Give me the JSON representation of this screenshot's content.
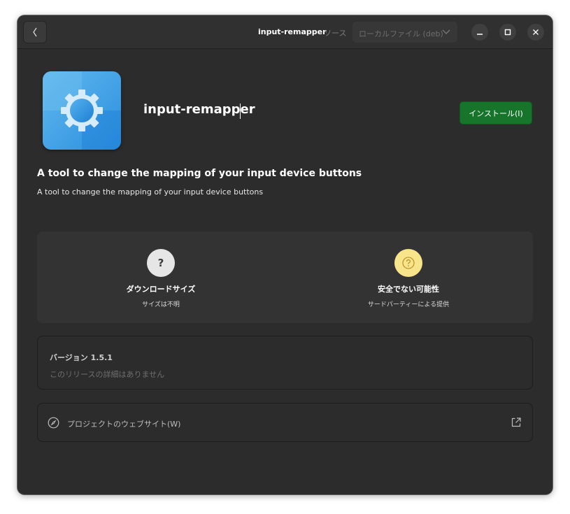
{
  "header": {
    "back_icon": "chevron-left-icon",
    "title": "input-remapper",
    "source_label": "ソース",
    "source_value": "ローカルファイル (deb)",
    "minimize_icon": "minimize-icon",
    "maximize_icon": "maximize-icon",
    "close_icon": "close-icon"
  },
  "app": {
    "icon": "gear-icon",
    "name": "input-remapper",
    "install_label": "インストール(I)",
    "install_color": "#16752a",
    "summary_title": "A tool to change the mapping of your input device buttons",
    "summary_text": "A tool to change the mapping of your input device buttons"
  },
  "context": {
    "download": {
      "icon_glyph": "?",
      "title": "ダウンロードサイズ",
      "subtitle": "サイズは不明"
    },
    "safety": {
      "icon_glyph": "?",
      "title": "安全でない可能性",
      "subtitle": "サードパーティーによる提供",
      "color": "#f8e48a"
    }
  },
  "version": {
    "title": "バージョン 1.5.1",
    "note": "このリリースの詳細はありません"
  },
  "website": {
    "icon": "compass-icon",
    "label": "プロジェクトのウェブサイト(W)",
    "link_icon": "external-link-icon"
  }
}
